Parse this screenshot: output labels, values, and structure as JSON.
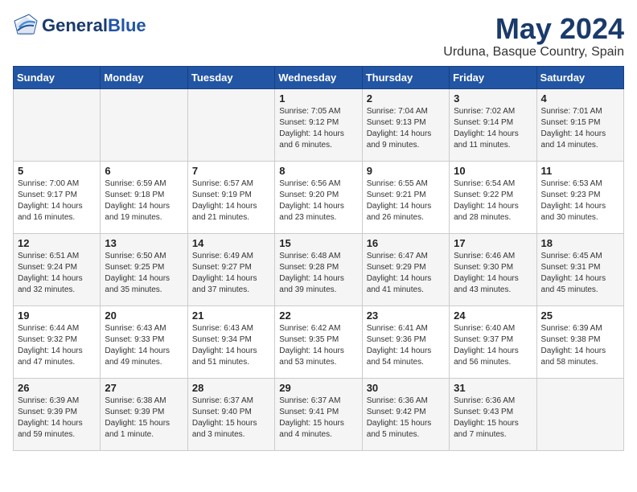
{
  "header": {
    "logo_general": "General",
    "logo_blue": "Blue",
    "month": "May 2024",
    "location": "Urduna, Basque Country, Spain"
  },
  "weekdays": [
    "Sunday",
    "Monday",
    "Tuesday",
    "Wednesday",
    "Thursday",
    "Friday",
    "Saturday"
  ],
  "weeks": [
    [
      {
        "day": "",
        "info": ""
      },
      {
        "day": "",
        "info": ""
      },
      {
        "day": "",
        "info": ""
      },
      {
        "day": "1",
        "info": "Sunrise: 7:05 AM\nSunset: 9:12 PM\nDaylight: 14 hours\nand 6 minutes."
      },
      {
        "day": "2",
        "info": "Sunrise: 7:04 AM\nSunset: 9:13 PM\nDaylight: 14 hours\nand 9 minutes."
      },
      {
        "day": "3",
        "info": "Sunrise: 7:02 AM\nSunset: 9:14 PM\nDaylight: 14 hours\nand 11 minutes."
      },
      {
        "day": "4",
        "info": "Sunrise: 7:01 AM\nSunset: 9:15 PM\nDaylight: 14 hours\nand 14 minutes."
      }
    ],
    [
      {
        "day": "5",
        "info": "Sunrise: 7:00 AM\nSunset: 9:17 PM\nDaylight: 14 hours\nand 16 minutes."
      },
      {
        "day": "6",
        "info": "Sunrise: 6:59 AM\nSunset: 9:18 PM\nDaylight: 14 hours\nand 19 minutes."
      },
      {
        "day": "7",
        "info": "Sunrise: 6:57 AM\nSunset: 9:19 PM\nDaylight: 14 hours\nand 21 minutes."
      },
      {
        "day": "8",
        "info": "Sunrise: 6:56 AM\nSunset: 9:20 PM\nDaylight: 14 hours\nand 23 minutes."
      },
      {
        "day": "9",
        "info": "Sunrise: 6:55 AM\nSunset: 9:21 PM\nDaylight: 14 hours\nand 26 minutes."
      },
      {
        "day": "10",
        "info": "Sunrise: 6:54 AM\nSunset: 9:22 PM\nDaylight: 14 hours\nand 28 minutes."
      },
      {
        "day": "11",
        "info": "Sunrise: 6:53 AM\nSunset: 9:23 PM\nDaylight: 14 hours\nand 30 minutes."
      }
    ],
    [
      {
        "day": "12",
        "info": "Sunrise: 6:51 AM\nSunset: 9:24 PM\nDaylight: 14 hours\nand 32 minutes."
      },
      {
        "day": "13",
        "info": "Sunrise: 6:50 AM\nSunset: 9:25 PM\nDaylight: 14 hours\nand 35 minutes."
      },
      {
        "day": "14",
        "info": "Sunrise: 6:49 AM\nSunset: 9:27 PM\nDaylight: 14 hours\nand 37 minutes."
      },
      {
        "day": "15",
        "info": "Sunrise: 6:48 AM\nSunset: 9:28 PM\nDaylight: 14 hours\nand 39 minutes."
      },
      {
        "day": "16",
        "info": "Sunrise: 6:47 AM\nSunset: 9:29 PM\nDaylight: 14 hours\nand 41 minutes."
      },
      {
        "day": "17",
        "info": "Sunrise: 6:46 AM\nSunset: 9:30 PM\nDaylight: 14 hours\nand 43 minutes."
      },
      {
        "day": "18",
        "info": "Sunrise: 6:45 AM\nSunset: 9:31 PM\nDaylight: 14 hours\nand 45 minutes."
      }
    ],
    [
      {
        "day": "19",
        "info": "Sunrise: 6:44 AM\nSunset: 9:32 PM\nDaylight: 14 hours\nand 47 minutes."
      },
      {
        "day": "20",
        "info": "Sunrise: 6:43 AM\nSunset: 9:33 PM\nDaylight: 14 hours\nand 49 minutes."
      },
      {
        "day": "21",
        "info": "Sunrise: 6:43 AM\nSunset: 9:34 PM\nDaylight: 14 hours\nand 51 minutes."
      },
      {
        "day": "22",
        "info": "Sunrise: 6:42 AM\nSunset: 9:35 PM\nDaylight: 14 hours\nand 53 minutes."
      },
      {
        "day": "23",
        "info": "Sunrise: 6:41 AM\nSunset: 9:36 PM\nDaylight: 14 hours\nand 54 minutes."
      },
      {
        "day": "24",
        "info": "Sunrise: 6:40 AM\nSunset: 9:37 PM\nDaylight: 14 hours\nand 56 minutes."
      },
      {
        "day": "25",
        "info": "Sunrise: 6:39 AM\nSunset: 9:38 PM\nDaylight: 14 hours\nand 58 minutes."
      }
    ],
    [
      {
        "day": "26",
        "info": "Sunrise: 6:39 AM\nSunset: 9:39 PM\nDaylight: 14 hours\nand 59 minutes."
      },
      {
        "day": "27",
        "info": "Sunrise: 6:38 AM\nSunset: 9:39 PM\nDaylight: 15 hours\nand 1 minute."
      },
      {
        "day": "28",
        "info": "Sunrise: 6:37 AM\nSunset: 9:40 PM\nDaylight: 15 hours\nand 3 minutes."
      },
      {
        "day": "29",
        "info": "Sunrise: 6:37 AM\nSunset: 9:41 PM\nDaylight: 15 hours\nand 4 minutes."
      },
      {
        "day": "30",
        "info": "Sunrise: 6:36 AM\nSunset: 9:42 PM\nDaylight: 15 hours\nand 5 minutes."
      },
      {
        "day": "31",
        "info": "Sunrise: 6:36 AM\nSunset: 9:43 PM\nDaylight: 15 hours\nand 7 minutes."
      },
      {
        "day": "",
        "info": ""
      }
    ]
  ]
}
